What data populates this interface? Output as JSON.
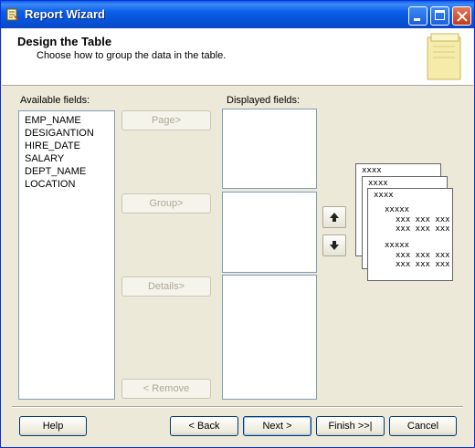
{
  "window": {
    "title": "Report Wizard"
  },
  "header": {
    "title": "Design the Table",
    "subtitle": "Choose how to group the data in the table."
  },
  "available": {
    "label": "Available fields:",
    "items": [
      "EMP_NAME",
      "DESIGANTION",
      "HIRE_DATE",
      "SALARY",
      "DEPT_NAME",
      "LOCATION"
    ]
  },
  "displayed": {
    "label": "Displayed fields:"
  },
  "actions": {
    "page": "Page>",
    "group": "Group>",
    "details": "Details>",
    "remove": "< Remove"
  },
  "preview": {
    "row1": "xxxx",
    "row2": "xxxx",
    "row3": "xxxx",
    "group1": "xxxxx",
    "line1": "xxx xxx xxx",
    "line2": "xxx xxx xxx",
    "group2": "xxxxx",
    "line3": "xxx xxx xxx",
    "line4": "xxx xxx xxx"
  },
  "footer": {
    "help": "Help",
    "back": "< Back",
    "next": "Next >",
    "finish": "Finish >>|",
    "cancel": "Cancel"
  }
}
